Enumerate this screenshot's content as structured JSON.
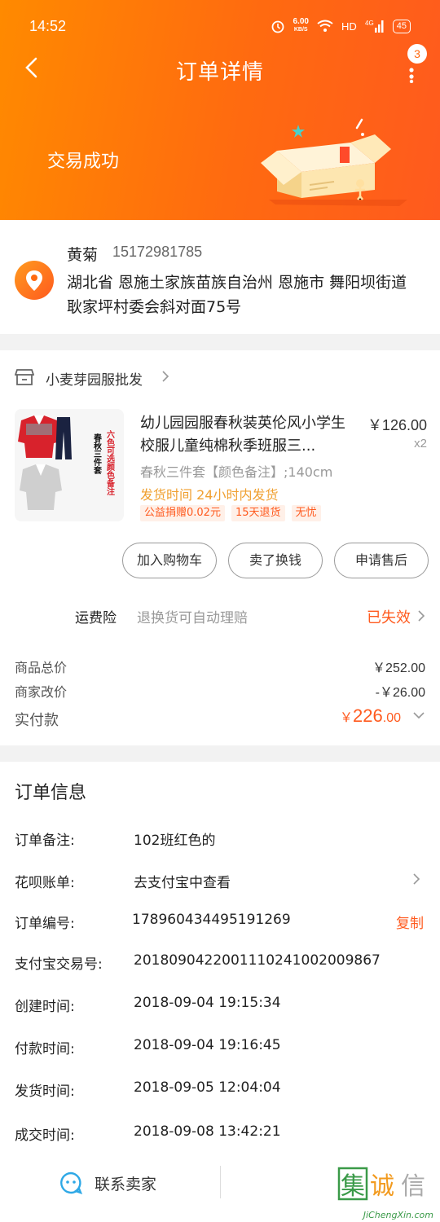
{
  "status_bar": {
    "time": "14:52",
    "speed_value": "6.00",
    "speed_unit": "KB/S",
    "hd": "HD",
    "net": "4G",
    "battery": "45"
  },
  "header": {
    "title": "订单详情",
    "badge": "3",
    "trade_status": "交易成功"
  },
  "address": {
    "name": "黄菊",
    "phone": "15172981785",
    "text": "湖北省 恩施土家族苗族自治州 恩施市 舞阳坝街道 耿家坪村委会斜对面75号"
  },
  "shop": {
    "name": "小麦芽园服批发"
  },
  "product": {
    "title": "幼儿园园服春秋装英伦风小学生校服儿童纯棉秋季班服三...",
    "price": "￥126.00",
    "qty": "x2",
    "sku": "春秋三件套【颜色备注】;140cm",
    "ship": "发货时间 24小时内发货",
    "tags": [
      "公益捐赠0.02元",
      "15天退货",
      "无忧"
    ],
    "thumb_text": [
      "春秋三件套",
      "六色可选颜色备注"
    ]
  },
  "actions": {
    "add_cart": "加入购物车",
    "resell": "卖了换钱",
    "after_sale": "申请售后"
  },
  "insurance": {
    "label": "运费险",
    "desc": "退换货可自动理赔",
    "status": "已失效"
  },
  "summary": {
    "goods_label": "商品总价",
    "goods_value": "￥252.00",
    "adjust_label": "商家改价",
    "adjust_value": "-￥26.00",
    "paid_label": "实付款",
    "paid_symbol": "￥",
    "paid_int": "226",
    "paid_dec": ".00"
  },
  "order_info": {
    "title": "订单信息",
    "rows": [
      {
        "label": "订单备注:",
        "value": "102班红色的"
      },
      {
        "label": "花呗账单:",
        "value": "去支付宝中查看"
      },
      {
        "label": "订单编号:",
        "value": "178960434495191269",
        "action": "复制"
      },
      {
        "label": "支付宝交易号:",
        "value": "2018090422001110241002009867"
      },
      {
        "label": "创建时间:",
        "value": "2018-09-04 19:15:34"
      },
      {
        "label": "付款时间:",
        "value": "2018-09-04 19:16:45"
      },
      {
        "label": "发货时间:",
        "value": "2018-09-05 12:04:04"
      },
      {
        "label": "成交时间:",
        "value": "2018-09-08 13:42:21"
      }
    ]
  },
  "bottom": {
    "contact": "联系卖家"
  },
  "watermark": {
    "chars": "集诚信",
    "site": "JiChengXin.com"
  },
  "colors": {
    "accent": "#ff5a1e",
    "header_start": "#ff8a00",
    "ship": "#f0a030"
  }
}
